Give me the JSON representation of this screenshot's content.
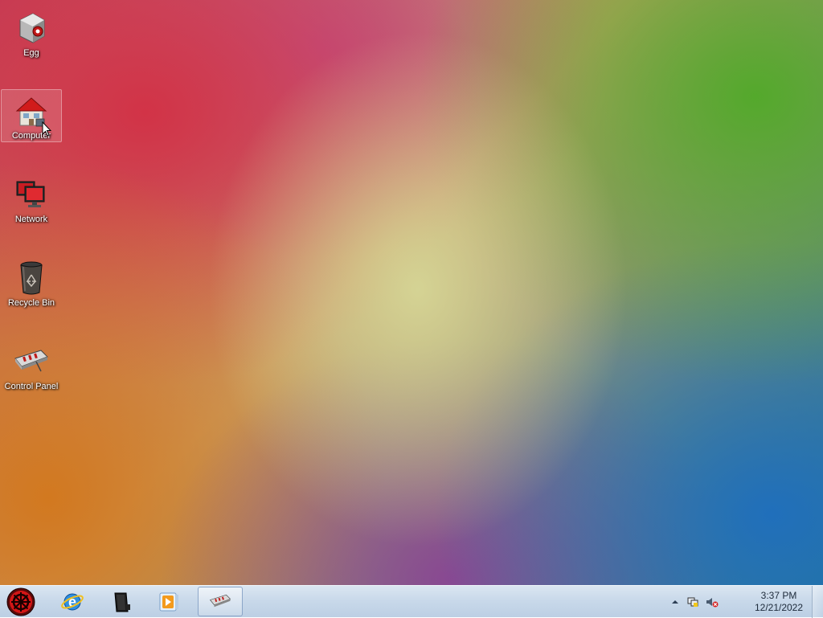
{
  "desktop": {
    "icons": [
      {
        "label": "Egg",
        "icon": "egg-app-icon"
      },
      {
        "label": "Computer",
        "icon": "computer-house-icon"
      },
      {
        "label": "Network",
        "icon": "network-monitors-icon"
      },
      {
        "label": "Recycle Bin",
        "icon": "recycle-bin-icon"
      },
      {
        "label": "Control Panel",
        "icon": "control-panel-icon"
      }
    ],
    "selected_icon": "Computer"
  },
  "taskbar": {
    "start_icon": "start-orb-icon",
    "pinned": [
      {
        "icon": "internet-explorer-icon"
      },
      {
        "icon": "media-device-icon"
      },
      {
        "icon": "media-player-icon"
      },
      {
        "icon": "control-panel-icon",
        "active": true
      }
    ],
    "tray": {
      "icons": [
        "show-hidden-icons-chevron",
        "network-tray-icon",
        "volume-muted-icon"
      ],
      "time": "3:37 PM",
      "date": "12/21/2022"
    }
  },
  "colors": {
    "taskbar_bg": "#c9d9ea",
    "label_text": "#ffffff",
    "clock_text": "#1d2a3a"
  }
}
